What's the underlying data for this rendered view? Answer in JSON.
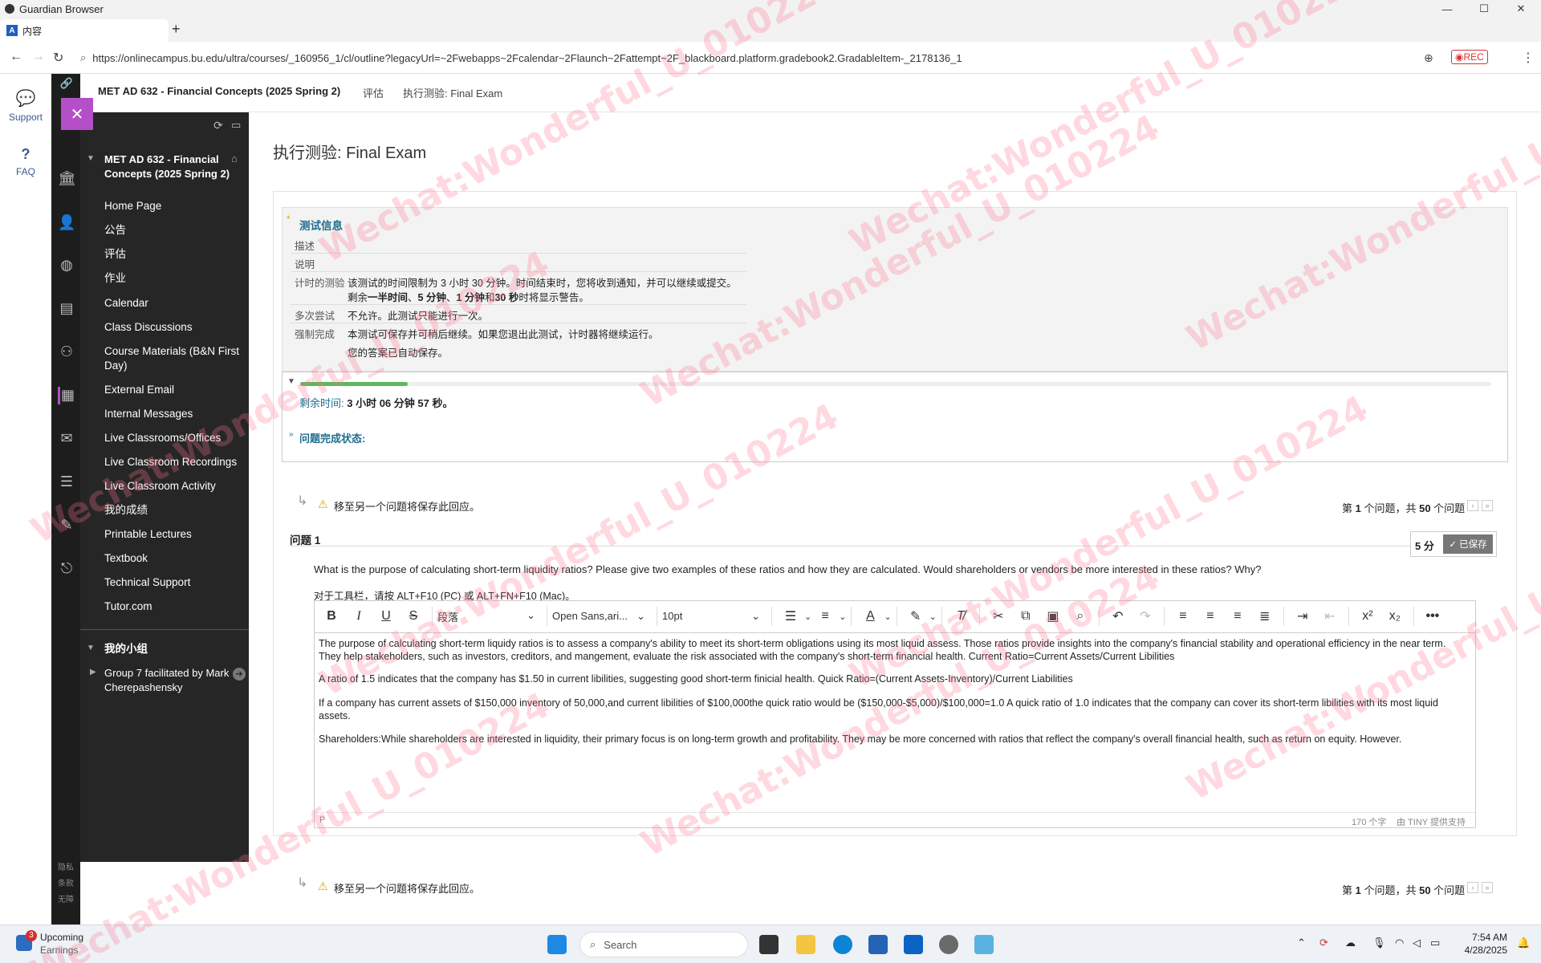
{
  "window": {
    "title": "Guardian Browser",
    "minimize": "—",
    "maximize": "☐",
    "close": "✕"
  },
  "tab": {
    "label": "内容",
    "favicon": "A",
    "new_tab": "+"
  },
  "address": {
    "url": "https://onlinecampus.bu.edu/ultra/courses/_160956_1/cl/outline?legacyUrl=~2Fwebapps~2Fcalendar~2Flaunch~2Fattempt~2F_blackboard.platform.gradebook2.GradableItem-_2178136_1",
    "rec": "◉REC"
  },
  "rail": {
    "support": "Support",
    "faq": "FAQ",
    "faq_icon": "?"
  },
  "breadcrumb": {
    "course": "MET AD 632 - Financial Concepts (2025 Spring 2)",
    "crumb2": "评估",
    "crumb3": "执行测验: Final Exam"
  },
  "sidebar": {
    "close": "✕",
    "course_title": "MET AD 632 - Financial Concepts (2025 Spring 2)",
    "items": [
      "Home Page",
      "公告",
      "评估",
      "作业",
      "Calendar",
      "Class Discussions",
      "Course Materials (B&N First Day)",
      "External Email",
      "Internal Messages",
      "Live Classrooms/Offices",
      "Live Classroom Recordings",
      "Live Classroom Activity",
      "我的成绩",
      "Printable Lectures",
      "Textbook",
      "Technical Support",
      "Tutor.com"
    ],
    "group_title": "我的小组",
    "group_item": "Group 7 facilitated by Mark Cherepashensky",
    "footer": [
      "隐私",
      "条款",
      "无障"
    ]
  },
  "page": {
    "title": "执行测验: Final Exam"
  },
  "info": {
    "heading": "测试信息",
    "desc_label": "描述",
    "instr_label": "说明",
    "timed_label": "计时的测验",
    "timed_text1": "该测试的时间限制为 3 小时 30 分钟。时间结束时，您将收到通知，并可以继续或提交。",
    "timed_text2a": "剩余",
    "timed_text2b": "一半时间",
    "timed_text2c": "、",
    "timed_text2d": "5 分钟",
    "timed_text2e": "、",
    "timed_text2f": "1 分钟",
    "timed_text2g": "和",
    "timed_text2h": "30 秒",
    "timed_text2i": "时将显示警告。",
    "multi_label": "多次尝试",
    "multi_text": "不允许。此测试只能进行一次。",
    "force_label": "强制完成",
    "force_text": "本测试可保存并可稍后继续。如果您退出此测试，计时器将继续运行。",
    "autosave": "您的答案已自动保存。"
  },
  "timer": {
    "label": "剩余时间:",
    "value": "3 小时 06 分钟 57 秒。",
    "progress": 0.09,
    "status_link": "问题完成状态:"
  },
  "nav": {
    "warning": "移至另一个问题将保存此回应。",
    "counter_a": "第 ",
    "counter_b": "1",
    "counter_c": " 个问题，共 ",
    "counter_d": "50",
    "counter_e": " 个问题"
  },
  "question": {
    "label": "问题 1",
    "points": "5 分",
    "saved": "✓ 已保存",
    "prompt": "What is the purpose of calculating short-term liquidity ratios?  Please give two examples of these ratios and how they are calculated.  Would shareholders or vendors be more interested in these ratios? Why?",
    "toolbar_hint": "对于工具栏，请按 ALT+F10 (PC) 或 ALT+FN+F10 (Mac)。"
  },
  "editor": {
    "paragraph": "段落",
    "font": "Open Sans,ari...",
    "size": "10pt",
    "p1": "The purpose of calculating short-term liquidy ratios is to assess a company's ability to meet its short-term obligations using its most liquid assess. Those ratios provide insights into the company's financial stability and operational efficiency in the near term. They help stakeholders, such as investors, creditors, and mangement, evaluate the risk associated with the company's short-term financial health.  Current Ratio=Current Assets/Current Libilities",
    "p2": "A ratio of 1.5 indicates that the company has $1.50 in current libilities, suggesting good short-term finicial health. Quick Ratio=(Current Assets-Inventory)/Current Liabilities",
    "p3": "If a company has current assets of $150,000 inventory of 50,000,and current libilities of $100,000the quick ratio would be ($150,000-$5,000)/$100,000=1.0 A quick ratio of 1.0 indicates that the company can cover its short-term libilities with its most liquid assets.",
    "p4": "Shareholders:While shareholders are interested in liquidity, their primary focus is on long-term growth and profitability. They may be more concerned with ratios that reflect the company's overall financial health, such as return on equity. However.",
    "status_p": "P",
    "word_count": "170 个字",
    "powered": "由 TINY 提供支持"
  },
  "taskbar": {
    "notif_badge": "3",
    "upcoming": "Upcoming",
    "earnings": "Earnings",
    "search": "Search",
    "time": "7:54 AM",
    "date": "4/28/2025"
  },
  "watermark": "Wechat:Wonderful_U_010224",
  "colors": {
    "accent": "#b44fc8",
    "link": "#1f6e8f",
    "sidebar_bg": "#262626",
    "progress": "#5cb85c"
  }
}
